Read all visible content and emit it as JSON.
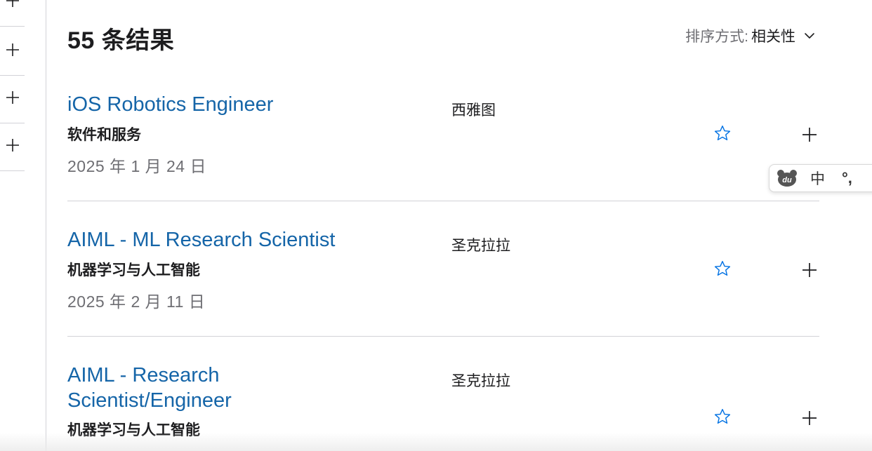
{
  "sidebar": {
    "rows": [
      {
        "icon": "plus-icon"
      },
      {
        "icon": "plus-icon"
      },
      {
        "icon": "plus-icon"
      },
      {
        "icon": "plus-icon"
      }
    ]
  },
  "results": {
    "count_text": "55 条结果"
  },
  "sort": {
    "label": "排序方式:",
    "value": "相关性",
    "icon": "chevron-down-icon"
  },
  "jobs": [
    {
      "title": "iOS Robotics Engineer",
      "team": "软件和服务",
      "date": "2025 年 1 月 24 日",
      "location": "西雅图"
    },
    {
      "title": "AIML - ML Research Scientist",
      "team": "机器学习与人工智能",
      "date": "2025 年 2 月 11 日",
      "location": "圣克拉拉"
    },
    {
      "title": "AIML - Research Scientist/Engineer",
      "team": "机器学习与人工智能",
      "date": "",
      "location": "圣克拉拉"
    }
  ],
  "ime": {
    "logo_text": "du",
    "lang": "中",
    "punct": "°,"
  },
  "colors": {
    "link": "#1565a8",
    "accent": "#0071e3",
    "divider": "#d2d2d7",
    "muted": "#6e6e73"
  }
}
